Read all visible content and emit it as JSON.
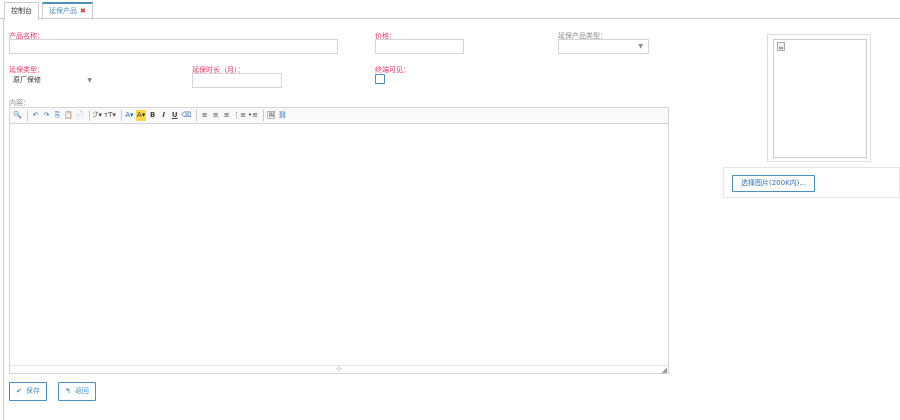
{
  "tabs": [
    {
      "label": "控制台"
    },
    {
      "label": "延保产品",
      "close": "✖"
    }
  ],
  "form": {
    "product_name": {
      "label": "产品名称：",
      "value": ""
    },
    "price": {
      "label": "价格：",
      "value": ""
    },
    "product_type": {
      "label": "延保产品类型：",
      "selected": ""
    },
    "warranty_type": {
      "label": "延保类型：",
      "selected": "原厂保修"
    },
    "duration": {
      "label": "延保时长（月）：",
      "value": ""
    },
    "terminal_visible": {
      "label": "终端可见：",
      "checked": false
    },
    "content": {
      "label": "内容："
    }
  },
  "toolbar_icons": [
    "preview-icon",
    "undo-icon",
    "redo-icon",
    "copy-icon",
    "paste-icon",
    "paste-word-icon",
    "font-family-icon",
    "font-size-icon",
    "font-color-icon",
    "highlight-icon",
    "bold-icon",
    "italic-icon",
    "underline-icon",
    "remove-format-icon",
    "align-left-icon",
    "align-center-icon",
    "align-right-icon",
    "ordered-list-icon",
    "unordered-list-icon",
    "image-icon",
    "link-icon"
  ],
  "buttons": {
    "save": {
      "icon": "✔",
      "label": "保存"
    },
    "back": {
      "icon": "↰",
      "label": "返回"
    }
  },
  "image_panel": {
    "upload_label": "选择图片(200K内)..."
  }
}
